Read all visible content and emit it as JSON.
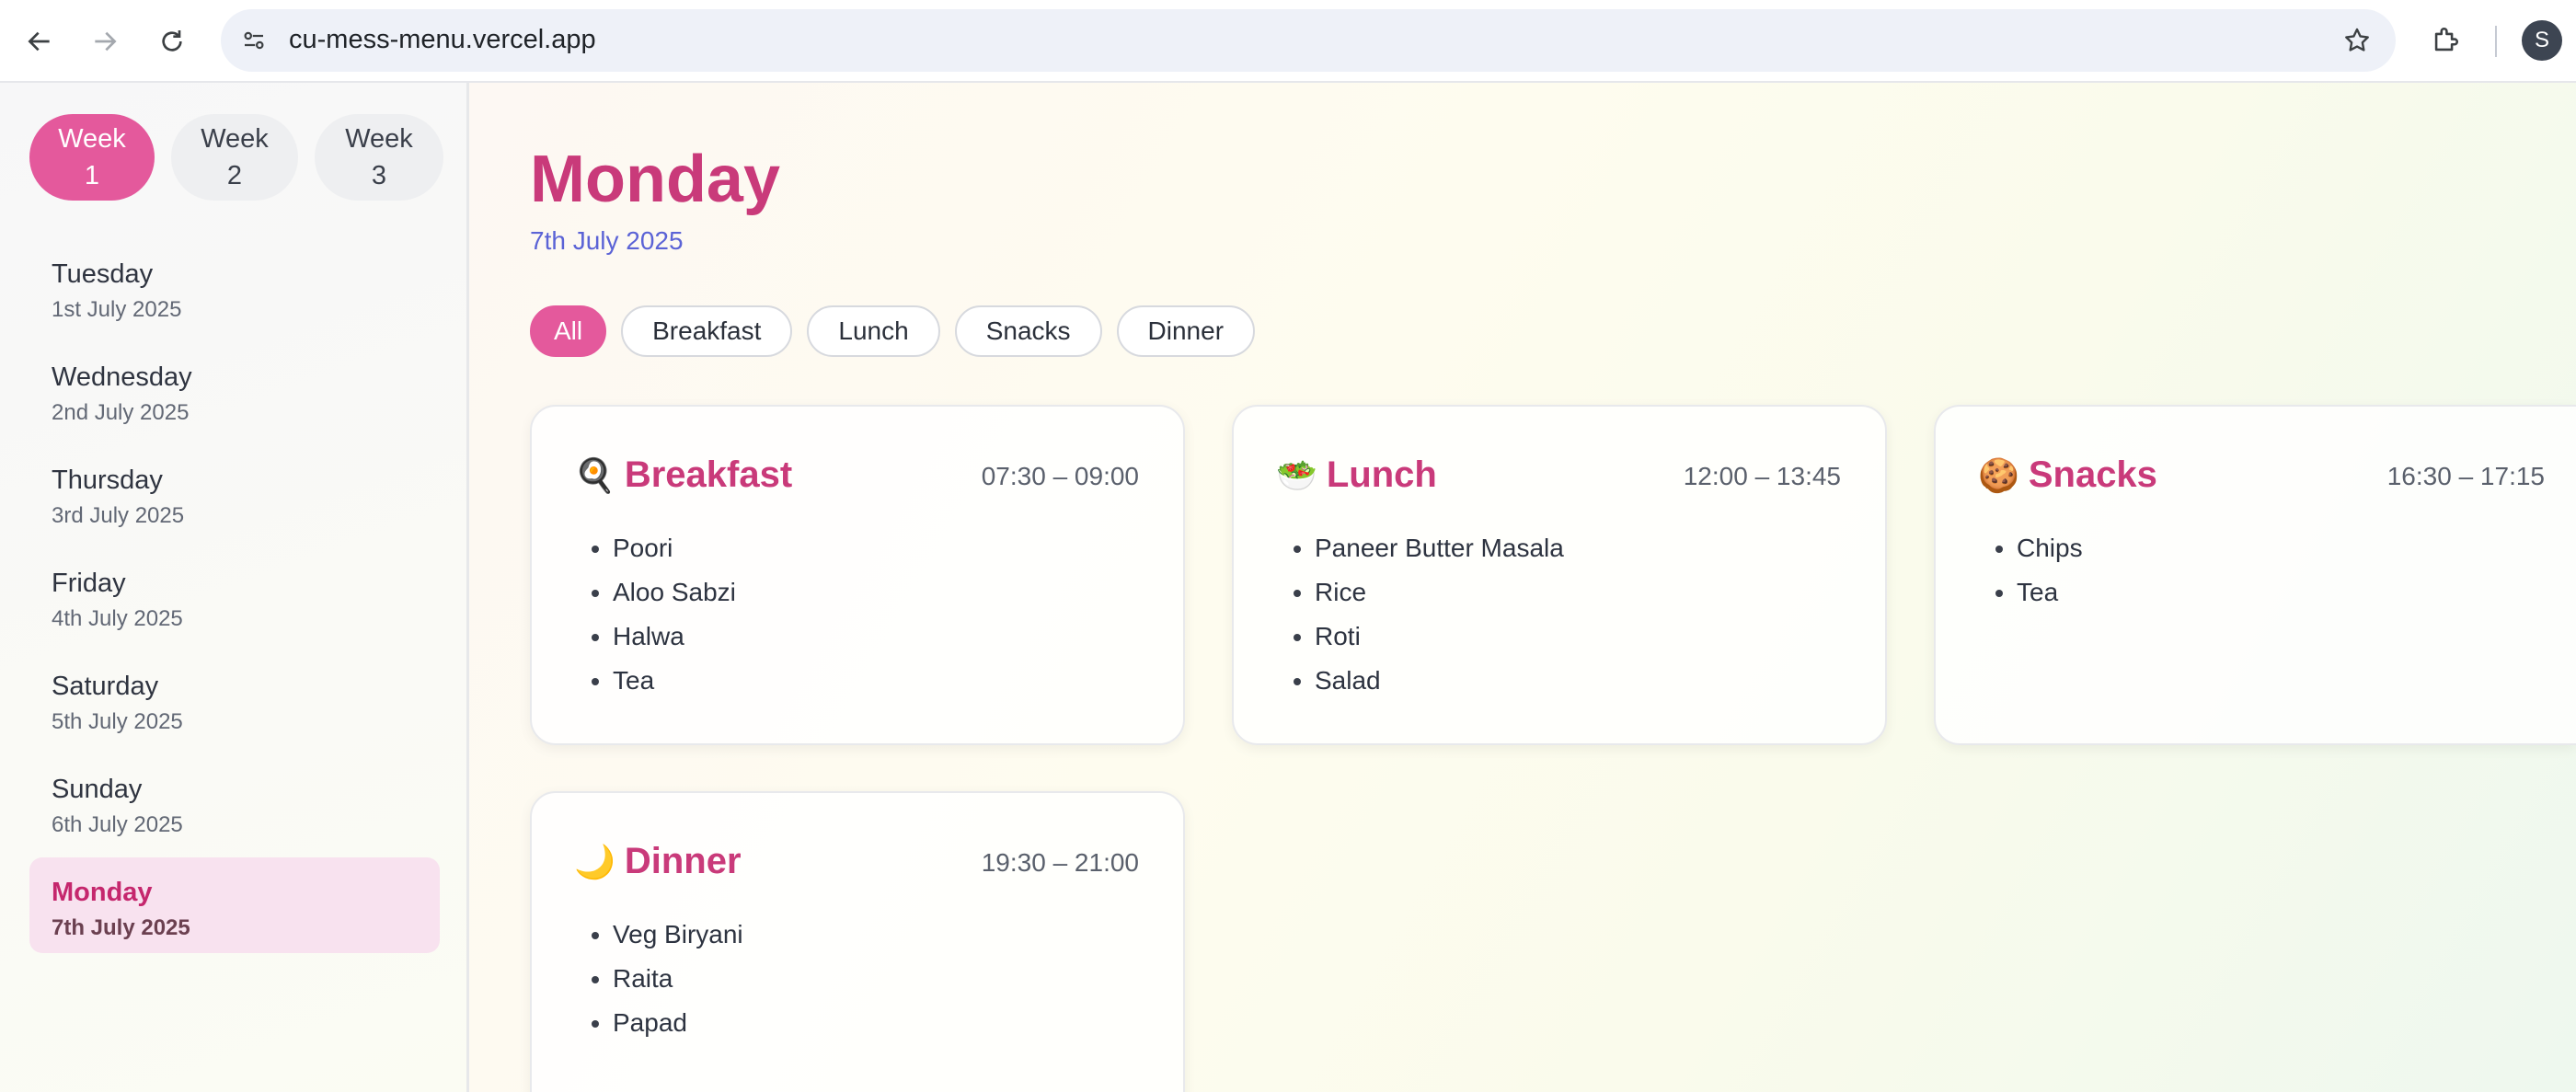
{
  "browser": {
    "url": "cu-mess-menu.vercel.app",
    "profile_initial": "S"
  },
  "sidebar": {
    "weeks": [
      {
        "label": "Week\n1",
        "active": true
      },
      {
        "label": "Week\n2",
        "active": false
      },
      {
        "label": "Week\n3",
        "active": false
      }
    ],
    "days": [
      {
        "name": "Tuesday",
        "date": "1st July 2025",
        "active": false
      },
      {
        "name": "Wednesday",
        "date": "2nd July 2025",
        "active": false
      },
      {
        "name": "Thursday",
        "date": "3rd July 2025",
        "active": false
      },
      {
        "name": "Friday",
        "date": "4th July 2025",
        "active": false
      },
      {
        "name": "Saturday",
        "date": "5th July 2025",
        "active": false
      },
      {
        "name": "Sunday",
        "date": "6th July 2025",
        "active": false
      },
      {
        "name": "Monday",
        "date": "7th July 2025",
        "active": true
      }
    ]
  },
  "main": {
    "day_title": "Monday",
    "date": "7th July 2025",
    "filters": [
      {
        "label": "All",
        "active": true
      },
      {
        "label": "Breakfast",
        "active": false
      },
      {
        "label": "Lunch",
        "active": false
      },
      {
        "label": "Snacks",
        "active": false
      },
      {
        "label": "Dinner",
        "active": false
      }
    ],
    "meals": [
      {
        "icon": "🍳",
        "icon_name": "frying-pan-icon",
        "name": "Breakfast",
        "time": "07:30 – 09:00",
        "items": [
          "Poori",
          "Aloo Sabzi",
          "Halwa",
          "Tea"
        ]
      },
      {
        "icon": "🥗",
        "icon_name": "salad-icon",
        "name": "Lunch",
        "time": "12:00 – 13:45",
        "items": [
          "Paneer Butter Masala",
          "Rice",
          "Roti",
          "Salad"
        ]
      },
      {
        "icon": "🍪",
        "icon_name": "cookie-icon",
        "name": "Snacks",
        "time": "16:30 – 17:15",
        "items": [
          "Chips",
          "Tea"
        ]
      },
      {
        "icon": "🌙",
        "icon_name": "moon-icon",
        "name": "Dinner",
        "time": "19:30 – 21:00",
        "items": [
          "Veg Biryani",
          "Raita",
          "Papad"
        ]
      }
    ]
  },
  "colors": {
    "accent": "#e4599c",
    "title": "#c93a7a",
    "date": "#5b63d6"
  }
}
